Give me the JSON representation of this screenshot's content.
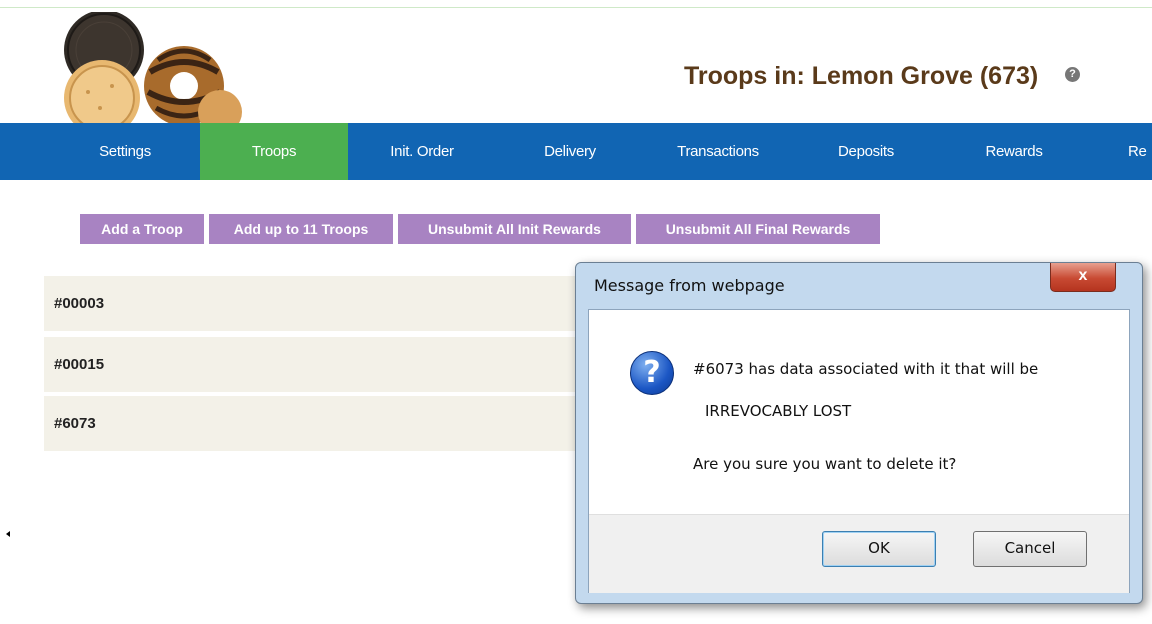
{
  "header": {
    "title": "Troops in: Lemon Grove (673)",
    "help_icon": "?"
  },
  "nav": {
    "items": [
      {
        "label": "Settings"
      },
      {
        "label": "Troops"
      },
      {
        "label": "Init. Order"
      },
      {
        "label": "Delivery"
      },
      {
        "label": "Transactions"
      },
      {
        "label": "Deposits"
      },
      {
        "label": "Rewards"
      },
      {
        "label": "Re"
      }
    ],
    "active": "Troops"
  },
  "actions": {
    "add_troop": "Add a Troop",
    "add_multiple": "Add up to 11 Troops",
    "unsubmit_init": "Unsubmit All Init Rewards",
    "unsubmit_final": "Unsubmit All Final Rewards"
  },
  "troops": [
    {
      "id": "#00003"
    },
    {
      "id": "#00015"
    },
    {
      "id": "#6073"
    }
  ],
  "dialog": {
    "title": "Message from webpage",
    "close_label": "x",
    "icon": "question-icon",
    "line1": "#6073 has data associated with it that will be",
    "line2": "IRREVOCABLY LOST",
    "line3": "Are you sure you want to delete it?",
    "ok_label": "OK",
    "cancel_label": "Cancel"
  },
  "colors": {
    "nav_bg": "#1165b3",
    "nav_active": "#4caf50",
    "action_button": "#a883c2",
    "title_color": "#5a3a1a"
  }
}
